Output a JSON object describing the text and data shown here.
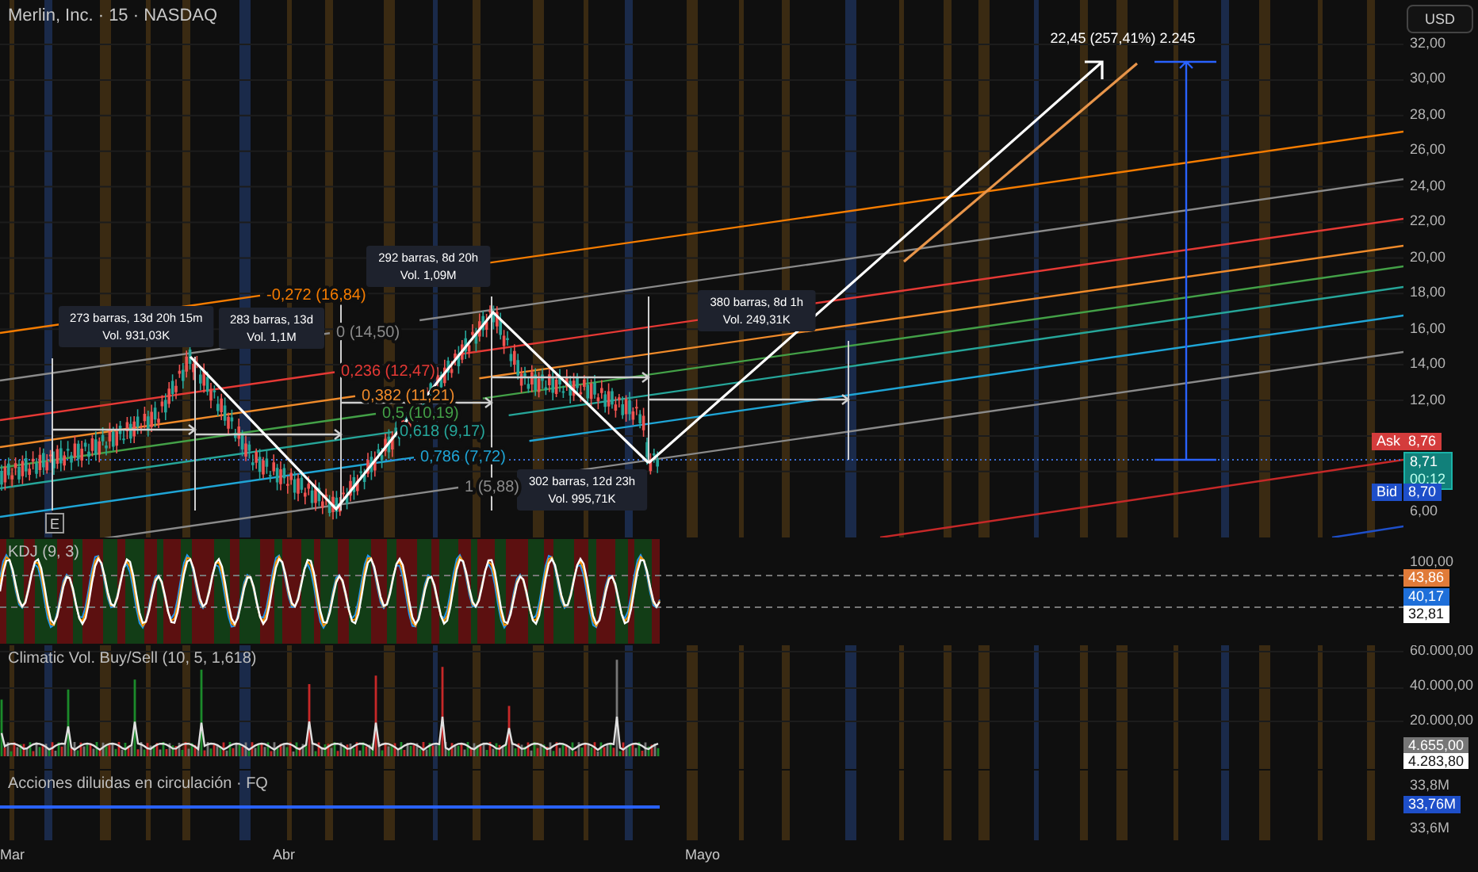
{
  "header": {
    "symbol": "Merlin, Inc. · 15 · NASDAQ"
  },
  "currency_button": "USD",
  "fib_levels": [
    {
      "label": "-0,272 (16,84)",
      "color": "#f57c00"
    },
    {
      "label": "0 (14,50)",
      "color": "#8a8a8a"
    },
    {
      "label": "0,236 (12,47)",
      "color": "#e53935"
    },
    {
      "label": "0,382 (11,21)",
      "color": "#ef8a2a"
    },
    {
      "label": "0,5 (10,19)",
      "color": "#43a047"
    },
    {
      "label": "0,618 (9,17)",
      "color": "#26a69a"
    },
    {
      "label": "0,786 (7,72)",
      "color": "#1fa5d6"
    },
    {
      "label": "1 (5,88)",
      "color": "#8a8a8a"
    }
  ],
  "measurements": [
    {
      "bars": "273 barras, 13d 20h 15m",
      "volume": "Vol. 931,03K"
    },
    {
      "bars": "283 barras, 13d",
      "volume": "Vol. 1,1M"
    },
    {
      "bars": "292 barras, 8d 20h",
      "volume": "Vol. 1,09M"
    },
    {
      "bars": "302 barras, 12d 23h",
      "volume": "Vol. 995,71K"
    },
    {
      "bars": "380 barras, 8d 1h",
      "volume": "Vol. 249,31K"
    }
  ],
  "projection": {
    "label": "22,45 (257,41%) 2.245"
  },
  "event_marker": "E",
  "price_axis": {
    "labels": [
      "32,00",
      "30,00",
      "28,00",
      "26,00",
      "24,00",
      "22,00",
      "20,00",
      "18,00",
      "16,00",
      "14,00",
      "12,00"
    ],
    "lower_label": "6,00"
  },
  "quotes": {
    "ask_label": "Ask",
    "ask": "8,76",
    "last": "8,71",
    "countdown": "00:12",
    "bid_label": "Bid",
    "bid": "8,70"
  },
  "kdj": {
    "title": "KDJ (9, 3)",
    "axis_label": "100,00",
    "values": [
      {
        "text": "43,86",
        "color": "#e07b39"
      },
      {
        "text": "40,17",
        "color": "#1e6fd9"
      },
      {
        "text": "32,81",
        "color": "#ffffff"
      }
    ]
  },
  "climatic_volume": {
    "title": "Climatic Vol. Buy/Sell (10, 5, 1,618)",
    "axis_labels": [
      "60.000,00",
      "40.000,00",
      "20.000,00"
    ],
    "last_value": "4.655,00",
    "average_value": "4.283,80"
  },
  "shares": {
    "title": "Acciones diluidas en circulación · FQ",
    "axis_labels": [
      "33,8M",
      "33,6M"
    ],
    "value": "33,76M"
  },
  "time_axis": [
    "Mar",
    "Abr",
    "Mayo"
  ]
}
